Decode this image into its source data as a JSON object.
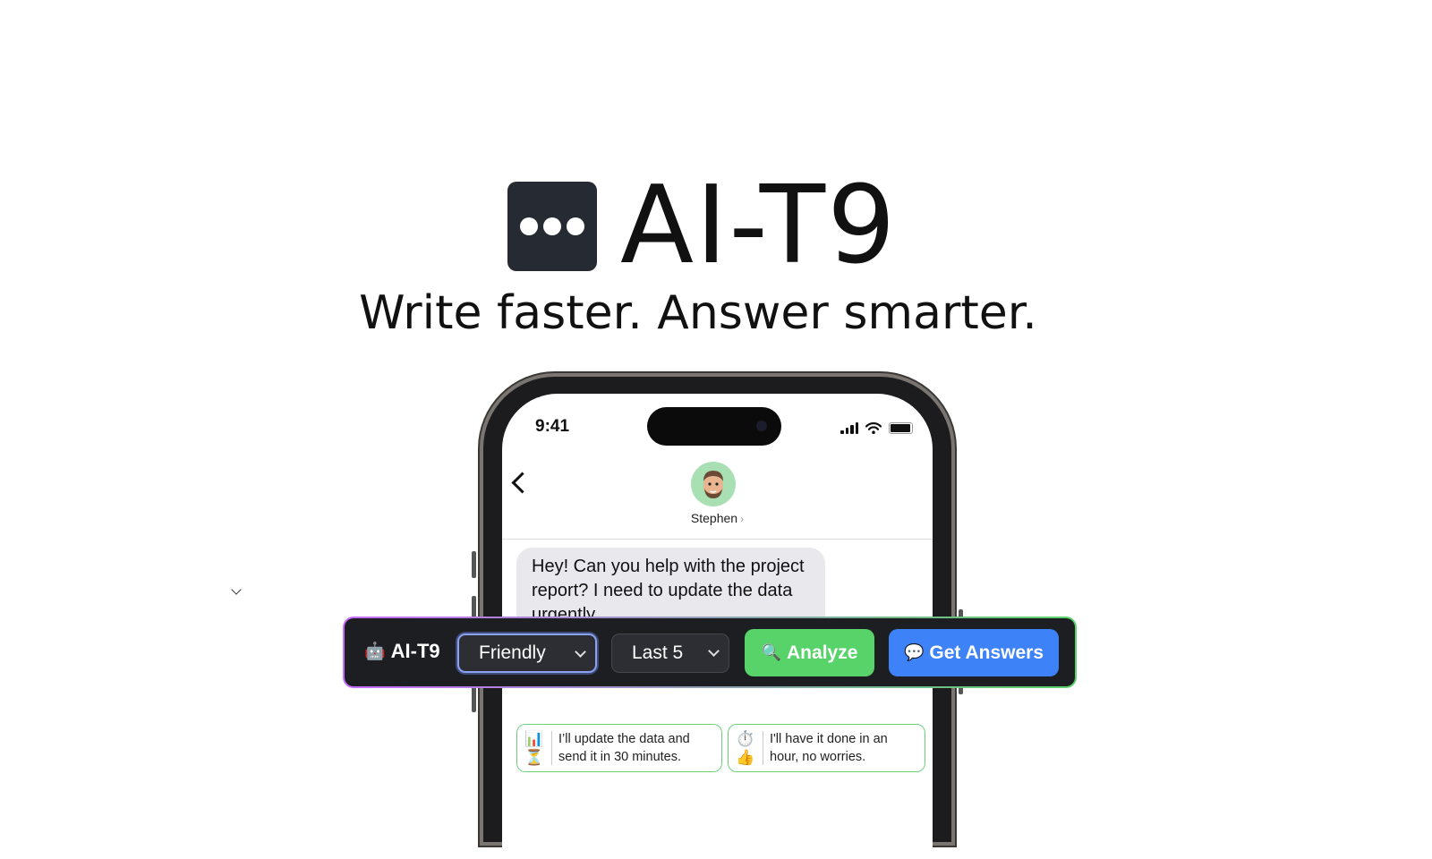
{
  "hero": {
    "brand": "AI-T9",
    "tagline": "Write faster. Answer smarter.",
    "logo_icon": "ellipsis-icon"
  },
  "phone": {
    "status": {
      "time": "9:41"
    },
    "contact": {
      "name": "Stephen"
    },
    "message": "Hey! Can you help with the project report? I need to update the data urgently",
    "suggestions": [
      {
        "emojis": [
          "📊",
          "⏳"
        ],
        "text": "I’ll update the data and send it in 30 minutes."
      },
      {
        "emojis": [
          "⏱️",
          "👍"
        ],
        "text": "I'll have it done in an hour, no worries."
      }
    ]
  },
  "toolbar": {
    "robot_emoji": "🤖",
    "brand": "AI-T9",
    "tone_value": "Friendly",
    "range_value": "Last 5",
    "analyze_emoji": "🔍",
    "analyze_label": "Analyze",
    "answers_emoji": "💬",
    "answers_label": "Get Answers"
  },
  "colors": {
    "analyze": "#57d36a",
    "get_answers": "#3e82f7",
    "toolbar_bg": "#1d1e22",
    "logo_bg": "#262a33"
  }
}
